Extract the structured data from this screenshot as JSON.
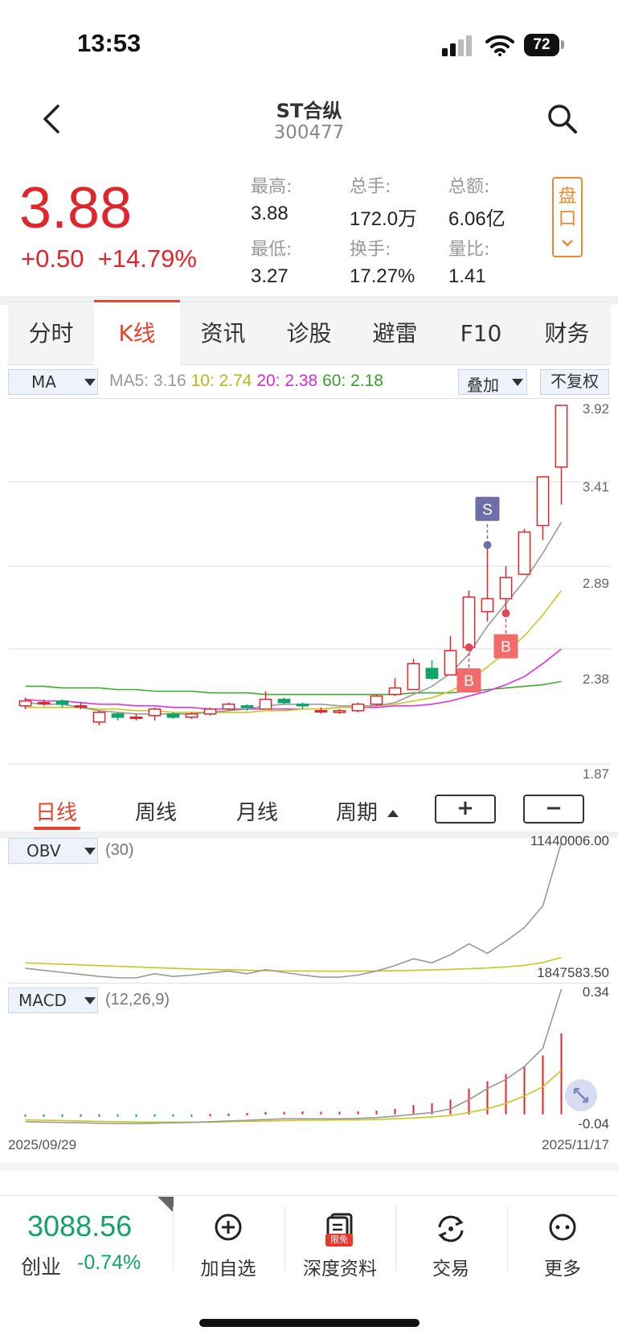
{
  "status_bar": {
    "time": "13:53",
    "battery": "72"
  },
  "header": {
    "back_icon": "chevron-left-icon",
    "title": "ST合纵",
    "code": "300477",
    "search_icon": "search-icon"
  },
  "quote": {
    "price": "3.88",
    "change": "+0.50",
    "change_pct": "+14.79%",
    "stats": [
      {
        "label": "最高:",
        "value": "3.88"
      },
      {
        "label": "总手:",
        "value": "172.0万"
      },
      {
        "label": "总额:",
        "value": "6.06亿"
      },
      {
        "label": "最低:",
        "value": "3.27"
      },
      {
        "label": "换手:",
        "value": "17.27%"
      },
      {
        "label": "量比:",
        "value": "1.41"
      }
    ],
    "pankou": [
      "盘",
      "口"
    ]
  },
  "tabs": [
    "分时",
    "K线",
    "资讯",
    "诊股",
    "避雷",
    "F10",
    "财务"
  ],
  "active_tab": "K线",
  "indicator_bar": {
    "selector": "MA",
    "ma5": "MA5: 3.16",
    "ma10": "10: 2.74",
    "ma20": "20: 2.38",
    "ma60": "60: 2.18",
    "overlay": "叠加",
    "adjust": "不复权"
  },
  "colors": {
    "up": "#e0262b",
    "down": "#12a36a",
    "ma5": "#999999",
    "ma10": "#c8c81e",
    "ma20": "#e030e0",
    "ma60": "#40a830",
    "accent": "#e5462d"
  },
  "chart_data": [
    {
      "type": "candlestick",
      "title": "",
      "y_ticks": [
        "3.92",
        "3.41",
        "2.89",
        "2.38",
        "1.87"
      ],
      "ylim": [
        1.87,
        3.92
      ],
      "x": [
        "2025/09/29",
        "2025/11/17"
      ],
      "candles": [
        {
          "o": 2.03,
          "c": 2.06,
          "h": 2.08,
          "l": 2.01
        },
        {
          "o": 2.05,
          "c": 2.05,
          "h": 2.07,
          "l": 2.03
        },
        {
          "o": 2.06,
          "c": 2.04,
          "h": 2.07,
          "l": 2.02
        },
        {
          "o": 2.03,
          "c": 2.03,
          "h": 2.05,
          "l": 2.01
        },
        {
          "o": 1.93,
          "c": 1.99,
          "h": 2.0,
          "l": 1.91
        },
        {
          "o": 1.98,
          "c": 1.96,
          "h": 1.99,
          "l": 1.94
        },
        {
          "o": 1.96,
          "c": 1.96,
          "h": 1.98,
          "l": 1.94
        },
        {
          "o": 1.97,
          "c": 2.01,
          "h": 2.02,
          "l": 1.94
        },
        {
          "o": 1.98,
          "c": 1.96,
          "h": 1.99,
          "l": 1.95
        },
        {
          "o": 1.96,
          "c": 1.98,
          "h": 1.99,
          "l": 1.95
        },
        {
          "o": 1.98,
          "c": 2.01,
          "h": 2.02,
          "l": 1.97
        },
        {
          "o": 2.01,
          "c": 2.04,
          "h": 2.05,
          "l": 2.0
        },
        {
          "o": 2.03,
          "c": 2.02,
          "h": 2.04,
          "l": 2.0
        },
        {
          "o": 2.01,
          "c": 2.07,
          "h": 2.12,
          "l": 2.01
        },
        {
          "o": 2.07,
          "c": 2.05,
          "h": 2.08,
          "l": 2.04
        },
        {
          "o": 2.04,
          "c": 2.03,
          "h": 2.05,
          "l": 2.01
        },
        {
          "o": 2.0,
          "c": 2.0,
          "h": 2.02,
          "l": 1.98
        },
        {
          "o": 1.99,
          "c": 2.0,
          "h": 2.01,
          "l": 1.98
        },
        {
          "o": 2.0,
          "c": 2.04,
          "h": 2.05,
          "l": 1.99
        },
        {
          "o": 2.04,
          "c": 2.09,
          "h": 2.1,
          "l": 2.03
        },
        {
          "o": 2.1,
          "c": 2.14,
          "h": 2.2,
          "l": 2.09
        },
        {
          "o": 2.13,
          "c": 2.29,
          "h": 2.32,
          "l": 2.13
        },
        {
          "o": 2.26,
          "c": 2.2,
          "h": 2.31,
          "l": 2.19
        },
        {
          "o": 2.22,
          "c": 2.37,
          "h": 2.46,
          "l": 2.22
        },
        {
          "o": 2.39,
          "c": 2.7,
          "h": 2.74,
          "l": 2.39
        },
        {
          "o": 2.61,
          "c": 2.69,
          "h": 3.02,
          "l": 2.55
        },
        {
          "o": 2.69,
          "c": 2.82,
          "h": 2.89,
          "l": 2.6
        },
        {
          "o": 2.84,
          "c": 3.1,
          "h": 3.12,
          "l": 2.84
        },
        {
          "o": 3.14,
          "c": 3.44,
          "h": 3.44,
          "l": 3.05
        },
        {
          "o": 3.5,
          "c": 3.88,
          "h": 3.88,
          "l": 3.27
        }
      ],
      "ma5": [
        2.05,
        2.04,
        2.04,
        2.02,
        2.0,
        1.99,
        1.98,
        1.98,
        1.98,
        1.98,
        1.99,
        2.0,
        2.01,
        2.03,
        2.04,
        2.04,
        2.04,
        2.03,
        2.03,
        2.03,
        2.05,
        2.1,
        2.15,
        2.23,
        2.35,
        2.52,
        2.66,
        2.8,
        2.97,
        3.16
      ],
      "ma10": [
        2.02,
        2.02,
        2.02,
        2.02,
        2.01,
        2.01,
        2.0,
        2.0,
        1.99,
        1.99,
        1.99,
        1.99,
        1.99,
        2.0,
        2.0,
        2.01,
        2.01,
        2.02,
        2.02,
        2.03,
        2.04,
        2.06,
        2.08,
        2.12,
        2.18,
        2.27,
        2.36,
        2.46,
        2.59,
        2.74
      ],
      "ma20": [
        2.07,
        2.06,
        2.06,
        2.05,
        2.04,
        2.04,
        2.03,
        2.03,
        2.02,
        2.02,
        2.01,
        2.01,
        2.01,
        2.01,
        2.01,
        2.01,
        2.01,
        2.02,
        2.02,
        2.02,
        2.03,
        2.03,
        2.04,
        2.06,
        2.09,
        2.12,
        2.16,
        2.21,
        2.29,
        2.38
      ],
      "ma60": [
        2.15,
        2.15,
        2.14,
        2.14,
        2.14,
        2.13,
        2.13,
        2.12,
        2.12,
        2.12,
        2.11,
        2.11,
        2.11,
        2.1,
        2.1,
        2.1,
        2.1,
        2.1,
        2.1,
        2.1,
        2.1,
        2.11,
        2.11,
        2.11,
        2.12,
        2.13,
        2.14,
        2.15,
        2.16,
        2.18
      ],
      "markers": [
        {
          "label": "S",
          "index": 25,
          "price": 3.02,
          "type": "sell"
        },
        {
          "label": "B",
          "index": 24,
          "price": 2.39,
          "type": "buy"
        },
        {
          "label": "B",
          "index": 26,
          "price": 2.6,
          "type": "buy"
        }
      ]
    },
    {
      "type": "line",
      "name": "OBV",
      "params": "(30)",
      "y_ticks": [
        "11440006.00",
        "1847583.50"
      ],
      "ylim": [
        1847583.5,
        11440006.0
      ],
      "obv": [
        2200000,
        2050000,
        1900000,
        1750000,
        1600000,
        1500000,
        1500000,
        1800000,
        1600000,
        1700000,
        1850000,
        2000000,
        1800000,
        2100000,
        1900000,
        1700000,
        1550000,
        1550000,
        1700000,
        2000000,
        2400000,
        2900000,
        2600000,
        3200000,
        4000000,
        3300000,
        4200000,
        5200000,
        6800000,
        11440006
      ],
      "obv_ma": [
        2600000,
        2550000,
        2500000,
        2450000,
        2400000,
        2350000,
        2300000,
        2250000,
        2200000,
        2150000,
        2120000,
        2090000,
        2060000,
        2030000,
        2010000,
        2000000,
        1990000,
        1985000,
        1985000,
        2000000,
        2020000,
        2050000,
        2080000,
        2120000,
        2170000,
        2220000,
        2300000,
        2420000,
        2620000,
        3000000
      ]
    },
    {
      "type": "bar",
      "name": "MACD",
      "params": "(12,26,9)",
      "y_ticks": [
        "0.34",
        "-0.04"
      ],
      "ylim": [
        -0.04,
        0.34
      ],
      "hist": [
        -0.003,
        -0.003,
        -0.003,
        -0.003,
        -0.003,
        -0.003,
        -0.003,
        -0.003,
        -0.003,
        -0.003,
        0.001,
        0.002,
        0.004,
        0.006,
        0.007,
        0.008,
        0.007,
        0.007,
        0.008,
        0.01,
        0.015,
        0.025,
        0.03,
        0.04,
        0.07,
        0.09,
        0.11,
        0.13,
        0.16,
        0.22
      ],
      "dif": [
        -0.02,
        -0.021,
        -0.022,
        -0.023,
        -0.024,
        -0.025,
        -0.025,
        -0.024,
        -0.023,
        -0.022,
        -0.02,
        -0.018,
        -0.016,
        -0.014,
        -0.012,
        -0.012,
        -0.012,
        -0.012,
        -0.011,
        -0.009,
        -0.005,
        0.0,
        0.005,
        0.015,
        0.04,
        0.07,
        0.095,
        0.13,
        0.18,
        0.34
      ],
      "dea": [
        -0.015,
        -0.016,
        -0.017,
        -0.018,
        -0.019,
        -0.02,
        -0.021,
        -0.021,
        -0.021,
        -0.021,
        -0.021,
        -0.02,
        -0.019,
        -0.018,
        -0.017,
        -0.016,
        -0.016,
        -0.015,
        -0.015,
        -0.014,
        -0.012,
        -0.01,
        -0.007,
        -0.003,
        0.005,
        0.015,
        0.03,
        0.05,
        0.075,
        0.12
      ]
    }
  ],
  "periods": [
    "日线",
    "周线",
    "月线",
    "周期"
  ],
  "active_period": "日线",
  "zoom": {
    "plus": "+",
    "minus": "−"
  },
  "sub_indicators": {
    "obv_selector": "OBV",
    "macd_selector": "MACD"
  },
  "dates": {
    "start": "2025/09/29",
    "end": "2025/11/17"
  },
  "bottom_bar": {
    "index_value": "3088.56",
    "index_name": "创业",
    "index_pct": "-0.74%",
    "actions": [
      {
        "icon": "plus-circle-icon",
        "label": "加自选"
      },
      {
        "icon": "document-icon",
        "label": "深度资料",
        "badge": "限免"
      },
      {
        "icon": "sync-icon",
        "label": "交易"
      },
      {
        "icon": "more-icon",
        "label": "更多"
      }
    ]
  }
}
